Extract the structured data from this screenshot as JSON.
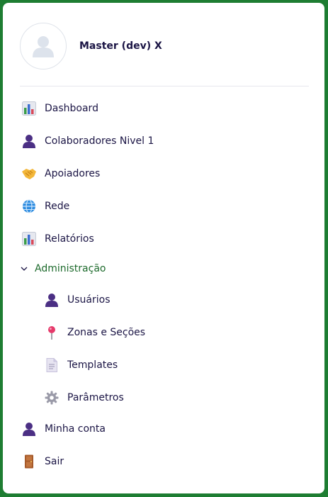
{
  "user": {
    "name": "Master (dev) X",
    "avatar_icon": "user-avatar-icon"
  },
  "menu": {
    "items": [
      {
        "label": "Dashboard",
        "icon": "bar-chart-icon"
      },
      {
        "label": "Colaboradores Nivel 1",
        "icon": "person-icon"
      },
      {
        "label": "Apoiadores",
        "icon": "handshake-icon"
      },
      {
        "label": "Rede",
        "icon": "globe-icon"
      },
      {
        "label": "Relatórios",
        "icon": "bar-chart-icon"
      }
    ],
    "admin_group": {
      "label": "Administração",
      "expanded": true,
      "items": [
        {
          "label": "Usuários",
          "icon": "person-icon"
        },
        {
          "label": "Zonas e Seções",
          "icon": "pin-icon"
        },
        {
          "label": "Templates",
          "icon": "document-icon"
        },
        {
          "label": "Parâmetros",
          "icon": "gear-icon"
        }
      ]
    },
    "footer_items": [
      {
        "label": "Minha conta",
        "icon": "person-icon"
      },
      {
        "label": "Sair",
        "icon": "door-icon"
      }
    ]
  },
  "colors": {
    "frame": "#1e7d32",
    "text": "#1b1545",
    "group_text": "#1e6b2d"
  }
}
